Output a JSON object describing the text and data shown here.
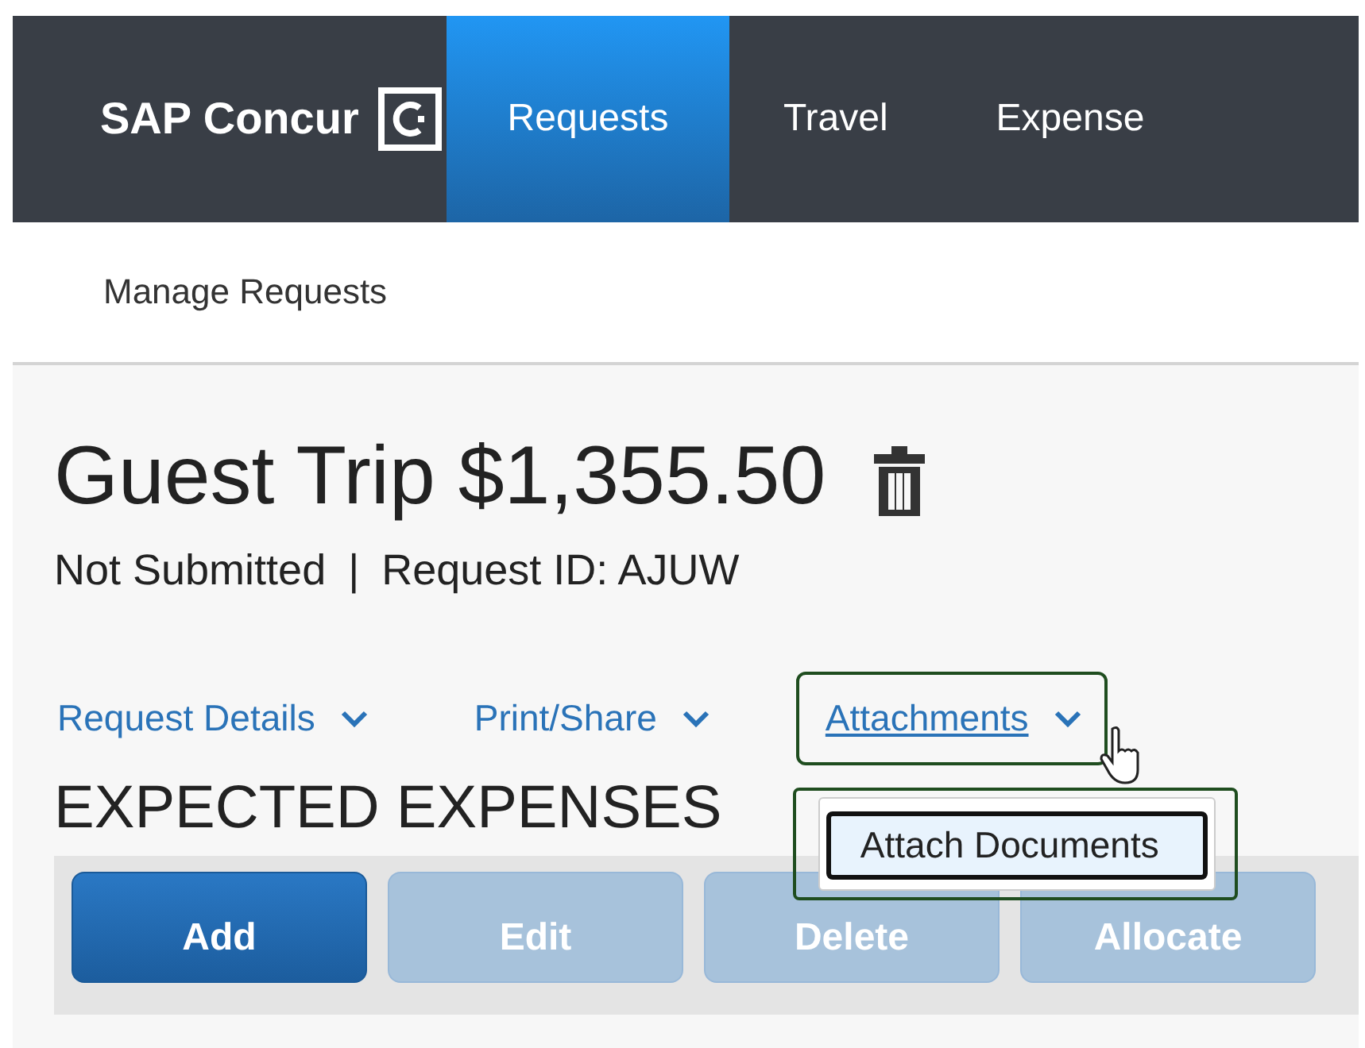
{
  "header": {
    "logo": "SAP Concur",
    "tabs": [
      {
        "label": "Requests",
        "selected": true
      },
      {
        "label": "Travel",
        "selected": false
      },
      {
        "label": "Expense",
        "selected": false
      }
    ]
  },
  "subnav": {
    "label": "Manage Requests"
  },
  "request": {
    "title": "Guest Trip $1,355.50",
    "status": "Not Submitted",
    "separator": "|",
    "request_id": "Request ID: AJUW"
  },
  "links": [
    {
      "label": "Request Details",
      "expanded": false
    },
    {
      "label": "Print/Share",
      "expanded": false
    },
    {
      "label": "Attachments",
      "expanded": true,
      "menu": [
        "Attach Documents"
      ]
    }
  ],
  "section": {
    "title": "EXPECTED EXPENSES"
  },
  "buttons": [
    {
      "label": "Add",
      "disabled": false
    },
    {
      "label": "Edit",
      "disabled": true
    },
    {
      "label": "Delete",
      "disabled": true
    },
    {
      "label": "Allocate",
      "disabled": true
    }
  ]
}
